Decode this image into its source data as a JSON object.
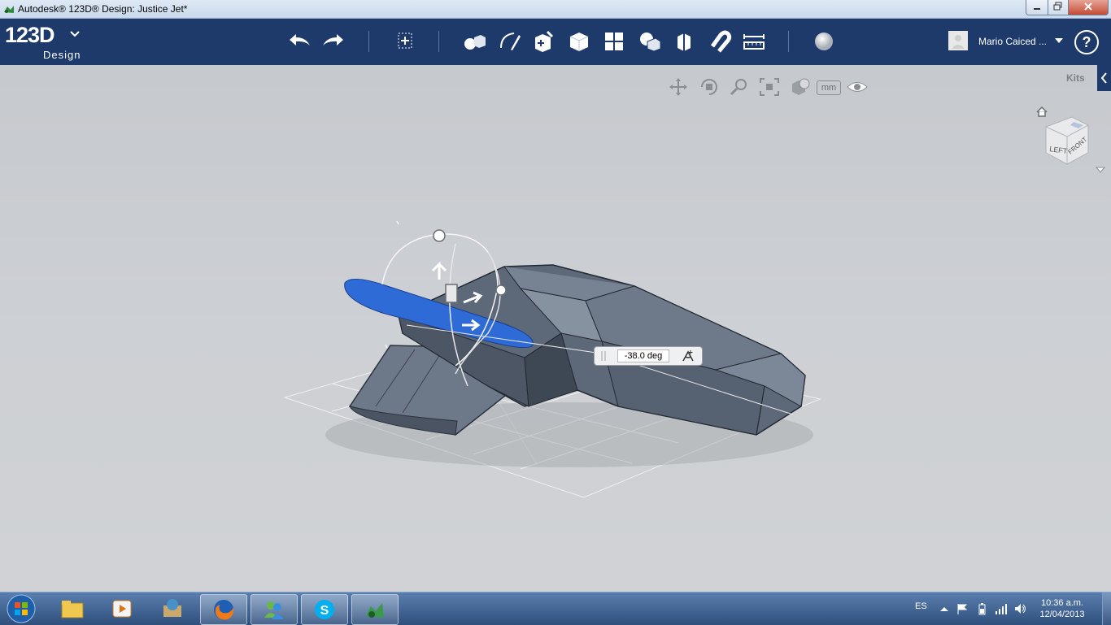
{
  "window": {
    "title": "Autodesk® 123D® Design: Justice Jet*",
    "buttons": [
      "minimize",
      "maximize",
      "close"
    ]
  },
  "logo": {
    "main": "123D",
    "sub": "Design"
  },
  "toolbar": {
    "tools": [
      "undo-icon",
      "redo-icon",
      "transform-icon",
      "primitives-icon",
      "sketch-icon",
      "construct-icon",
      "modify-icon",
      "pattern-icon",
      "grouping-icon",
      "combine-icon",
      "snap-icon",
      "measure-icon",
      "material-icon"
    ]
  },
  "user": {
    "name": "Mario Caiced ..."
  },
  "help": {
    "label": "?"
  },
  "viewport": {
    "units_label": "mm",
    "kits_label": "Kits",
    "viewcube": {
      "left": "LEFT",
      "front": "FRONT"
    },
    "angle_input": "-38.0 deg",
    "colors": {
      "selection": "#2f6bd6",
      "body": "#5b6675",
      "background": "#c9ccd0"
    }
  },
  "taskbar": {
    "apps": [
      "start-orb",
      "explorer-icon",
      "media-player-icon",
      "app-icon",
      "firefox-icon",
      "messenger-icon",
      "skype-icon",
      "123d-design-icon"
    ],
    "language": "ES",
    "time": "10:36 a.m.",
    "date": "12/04/2013"
  }
}
